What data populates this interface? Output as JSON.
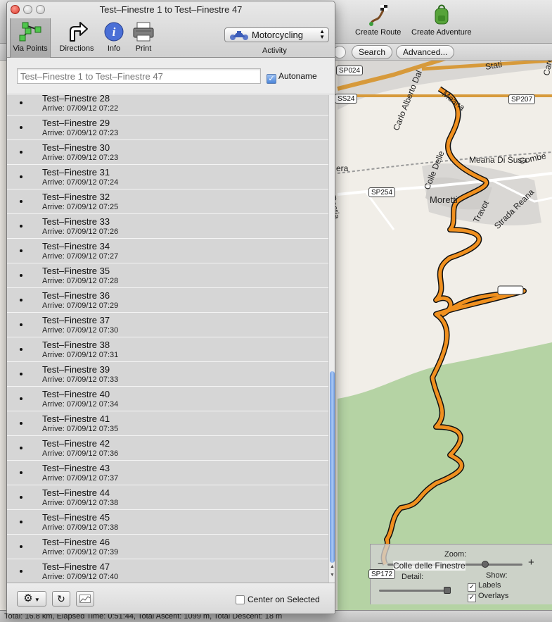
{
  "window": {
    "title": "Test–Finestre 1 to Test–Finestre 47",
    "toolbar": [
      {
        "label": "Via Points",
        "icon": "via-points-icon",
        "active": true
      },
      {
        "label": "Directions",
        "icon": "directions-arrow-icon",
        "active": false
      },
      {
        "label": "Info",
        "icon": "info-icon",
        "active": false
      },
      {
        "label": "Print",
        "icon": "printer-icon",
        "active": false
      }
    ],
    "activity": {
      "label": "Activity",
      "value": "Motorcycling"
    },
    "route_name_placeholder": "Test–Finestre 1 to Test–Finestre 47",
    "autoname": {
      "label": "Autoname",
      "checked": true
    },
    "via_points": [
      {
        "name": "Test–Finestre 28",
        "arrive": "Arrive: 07/09/12 07:22"
      },
      {
        "name": "Test–Finestre 29",
        "arrive": "Arrive: 07/09/12 07:23"
      },
      {
        "name": "Test–Finestre 30",
        "arrive": "Arrive: 07/09/12 07:23"
      },
      {
        "name": "Test–Finestre 31",
        "arrive": "Arrive: 07/09/12 07:24"
      },
      {
        "name": "Test–Finestre 32",
        "arrive": "Arrive: 07/09/12 07:25"
      },
      {
        "name": "Test–Finestre 33",
        "arrive": "Arrive: 07/09/12 07:26"
      },
      {
        "name": "Test–Finestre 34",
        "arrive": "Arrive: 07/09/12 07:27"
      },
      {
        "name": "Test–Finestre 35",
        "arrive": "Arrive: 07/09/12 07:28"
      },
      {
        "name": "Test–Finestre 36",
        "arrive": "Arrive: 07/09/12 07:29"
      },
      {
        "name": "Test–Finestre 37",
        "arrive": "Arrive: 07/09/12 07:30"
      },
      {
        "name": "Test–Finestre 38",
        "arrive": "Arrive: 07/09/12 07:31"
      },
      {
        "name": "Test–Finestre 39",
        "arrive": "Arrive: 07/09/12 07:33"
      },
      {
        "name": "Test–Finestre 40",
        "arrive": "Arrive: 07/09/12 07:34"
      },
      {
        "name": "Test–Finestre 41",
        "arrive": "Arrive: 07/09/12 07:35"
      },
      {
        "name": "Test–Finestre 42",
        "arrive": "Arrive: 07/09/12 07:36"
      },
      {
        "name": "Test–Finestre 43",
        "arrive": "Arrive: 07/09/12 07:37"
      },
      {
        "name": "Test–Finestre 44",
        "arrive": "Arrive: 07/09/12 07:38"
      },
      {
        "name": "Test–Finestre 45",
        "arrive": "Arrive: 07/09/12 07:38"
      },
      {
        "name": "Test–Finestre 46",
        "arrive": "Arrive: 07/09/12 07:39"
      },
      {
        "name": "Test–Finestre 47",
        "arrive": "Arrive: 07/09/12 07:40"
      }
    ],
    "bottom": {
      "gear_icon": "gear-icon",
      "refresh_icon": "refresh-icon",
      "profile_icon": "elevation-profile-icon",
      "center_on_selected": "Center on Selected"
    }
  },
  "app_toolbar": {
    "create_route": "Create Route",
    "create_adventure": "Create Adventure",
    "search_button": "Search",
    "advanced_button": "Advanced..."
  },
  "map": {
    "labels": {
      "carlo": "Carlo Alberto Dal",
      "meana": "Meana",
      "colle": "Colle Delle",
      "meana_di_susa": "Meana Di Susa",
      "combe": "Combe",
      "moretta": "Moretti",
      "travot": "Travot",
      "strada_reana": "Strada Reana",
      "rastia": "Rastia",
      "era": "era",
      "stati": "Stati",
      "careni": "Careni",
      "colle_finestre": "Colle delle Finestre"
    },
    "shields": {
      "sp024": "SP024",
      "ss24": "SS24",
      "sp207": "SP207",
      "sp254": "SP254",
      "sp172": "SP172"
    },
    "controls": {
      "zoom_label": "Zoom:",
      "detail_label": "Detail:",
      "show_label": "Show:",
      "labels_option": "Labels",
      "overlays_option": "Overlays"
    },
    "colors": {
      "route": "#f0901f",
      "route_outline": "#111111",
      "forest": "#b5d3a4",
      "land": "#f1eee8",
      "urban": "#d9d7d4",
      "major_road": "#d79a3b"
    }
  },
  "statusbar": {
    "text": "Total: 16.8 km, Elapsed Time: 0:51:44, Total Ascent: 1099 m, Total Descent: 18 m"
  }
}
